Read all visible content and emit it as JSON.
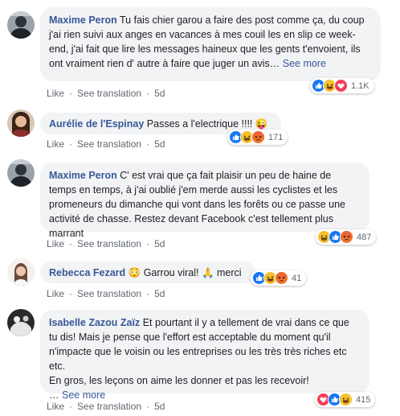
{
  "actions": {
    "like": "Like",
    "see_translation": "See translation",
    "separator": "·"
  },
  "see_more": "See more",
  "ellipsis": "…",
  "comments": [
    {
      "author": "Maxime Peron",
      "text": "Tu fais chier garou a faire des post comme ça, du coup j'ai rien suivi aux anges en vacances à mes couil les en slip ce week-end, j'ai fait que lire les messages haineux que les gents t'envoient, ils ont vraiment rien d' autre à faire que juger un avis",
      "time": "5d",
      "reactions": [
        "like-icon",
        "haha-icon",
        "love-icon"
      ],
      "reaction_count": "1.1K"
    },
    {
      "author": "Aurélie de l'Espinay",
      "text": "Passes a l'electrique !!!! 😜",
      "time": "5d",
      "reactions": [
        "like-icon",
        "haha-icon",
        "angry-icon"
      ],
      "reaction_count": "171"
    },
    {
      "author": "Maxime Peron",
      "text": "C' est vrai que ça fait plaisir un peu de haine de temps en temps, à j'ai oublié j'em merde aussi les cyclistes et les promeneurs du dimanche qui vont dans les forêts ou ce passe une activité de chasse. Restez devant Facebook c'est tellement plus marrant",
      "time": "5d",
      "reactions": [
        "haha-icon",
        "like-icon",
        "angry-icon"
      ],
      "reaction_count": "487"
    },
    {
      "author": "Rebecca Fezard",
      "text": "😳 Garrou viral! 🙏 merci",
      "time": "5d",
      "reactions": [
        "like-icon",
        "haha-icon",
        "angry-icon"
      ],
      "reaction_count": "41"
    },
    {
      "author": "Isabelle Zazou Zaïz",
      "text": "Et pourtant il y a tellement de vrai dans ce que tu dis! Mais je pense que l'effort est acceptable du moment qu'il n'impacte que le voisin ou les entreprises ou les très très riches etc etc.",
      "text2": "En gros, les leçons on aime les donner et pas les recevoir!",
      "time": "5d",
      "reactions": [
        "love-icon",
        "like-icon",
        "haha-icon"
      ],
      "reaction_count": "415"
    }
  ]
}
